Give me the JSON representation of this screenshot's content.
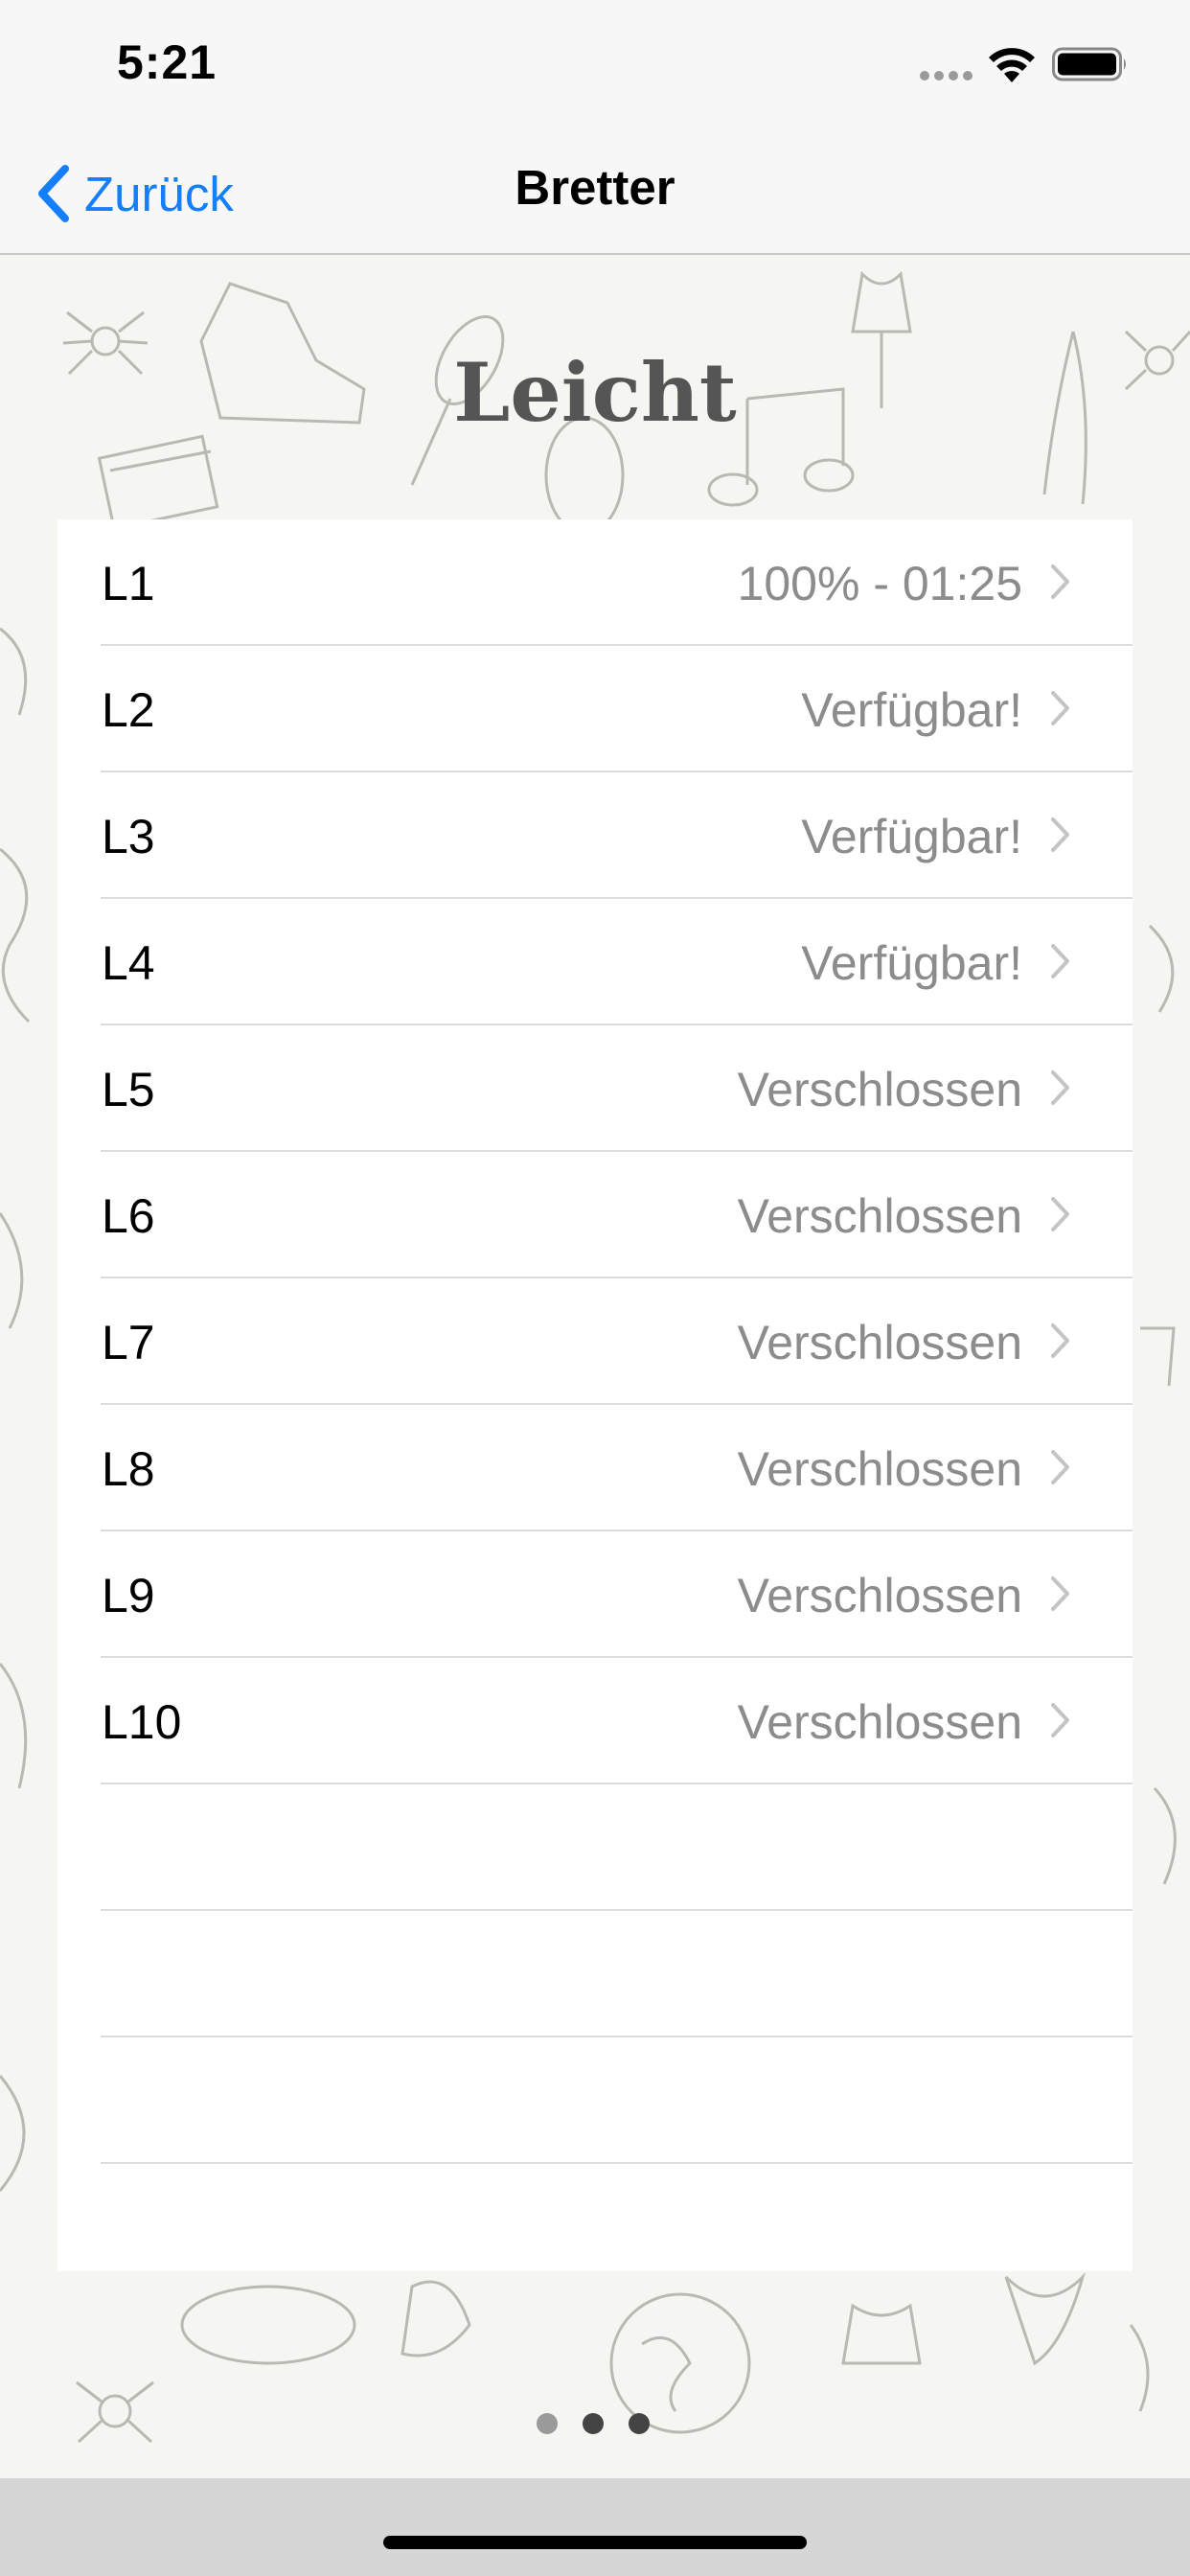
{
  "status_bar": {
    "time": "5:21"
  },
  "nav": {
    "back_label": "Zurück",
    "title": "Bretter"
  },
  "heading": "Leicht",
  "levels": [
    {
      "label": "L1",
      "status": "100% - 01:25"
    },
    {
      "label": "L2",
      "status": "Verfügbar!"
    },
    {
      "label": "L3",
      "status": "Verfügbar!"
    },
    {
      "label": "L4",
      "status": "Verfügbar!"
    },
    {
      "label": "L5",
      "status": "Verschlossen"
    },
    {
      "label": "L6",
      "status": "Verschlossen"
    },
    {
      "label": "L7",
      "status": "Verschlossen"
    },
    {
      "label": "L8",
      "status": "Verschlossen"
    },
    {
      "label": "L9",
      "status": "Verschlossen"
    },
    {
      "label": "L10",
      "status": "Verschlossen"
    }
  ],
  "page_indicator": {
    "count": 3,
    "current": 1
  },
  "colors": {
    "accent": "#147efb",
    "detail_text": "#8c8c8c",
    "heading": "#555555",
    "dot_active": "#444444",
    "dot_inactive": "#9a9a9a"
  },
  "icons": {
    "back": "chevron-left-icon",
    "disclosure": "chevron-right-icon",
    "wifi": "wifi-icon",
    "battery": "battery-icon"
  }
}
